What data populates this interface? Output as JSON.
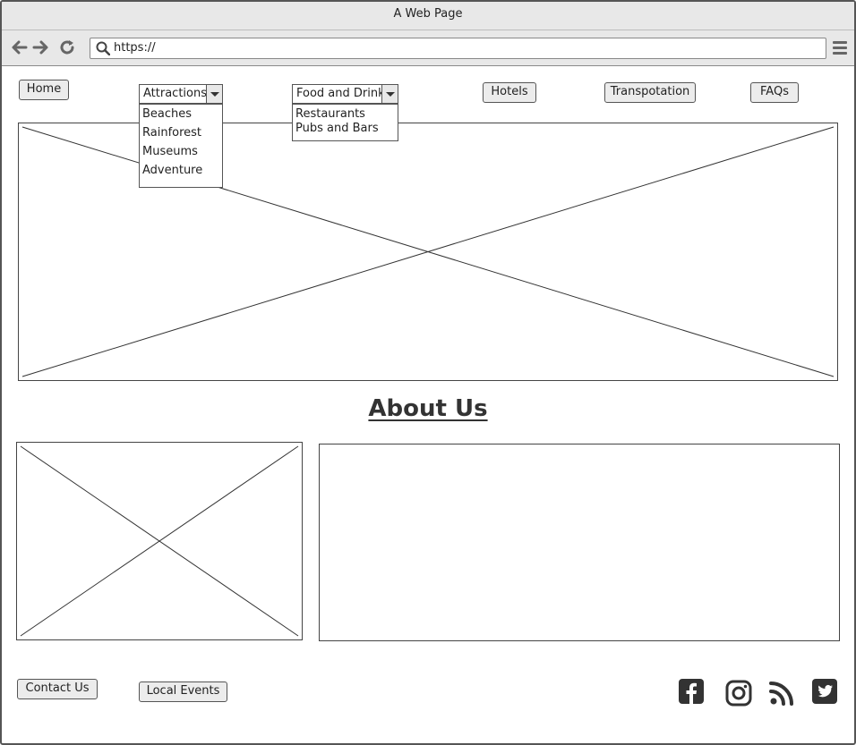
{
  "window": {
    "title": "A Web Page"
  },
  "browser": {
    "url": "https://",
    "icons": [
      "back-arrow-icon",
      "forward-arrow-icon",
      "reload-icon",
      "search-icon",
      "hamburger-menu-icon"
    ]
  },
  "nav": {
    "home": "Home",
    "attractions": {
      "label": "Attractions",
      "options": [
        "Beaches",
        "Rainforest",
        "Museums",
        "Adventure"
      ]
    },
    "food": {
      "label": "Food and Drink",
      "options": [
        "Restaurants",
        "Pubs and Bars"
      ]
    },
    "hotels": "Hotels",
    "transport": "Transpotation",
    "faqs": "FAQs"
  },
  "about": {
    "title": "About Us"
  },
  "footer": {
    "contact": "Contact Us",
    "events": "Local Events",
    "social_icons": [
      "facebook-icon",
      "instagram-icon",
      "rss-icon",
      "twitter-icon"
    ]
  },
  "colors": {
    "button_bg": "#ececec",
    "chrome_bg": "#e8e8e8",
    "icon": "#333333"
  }
}
